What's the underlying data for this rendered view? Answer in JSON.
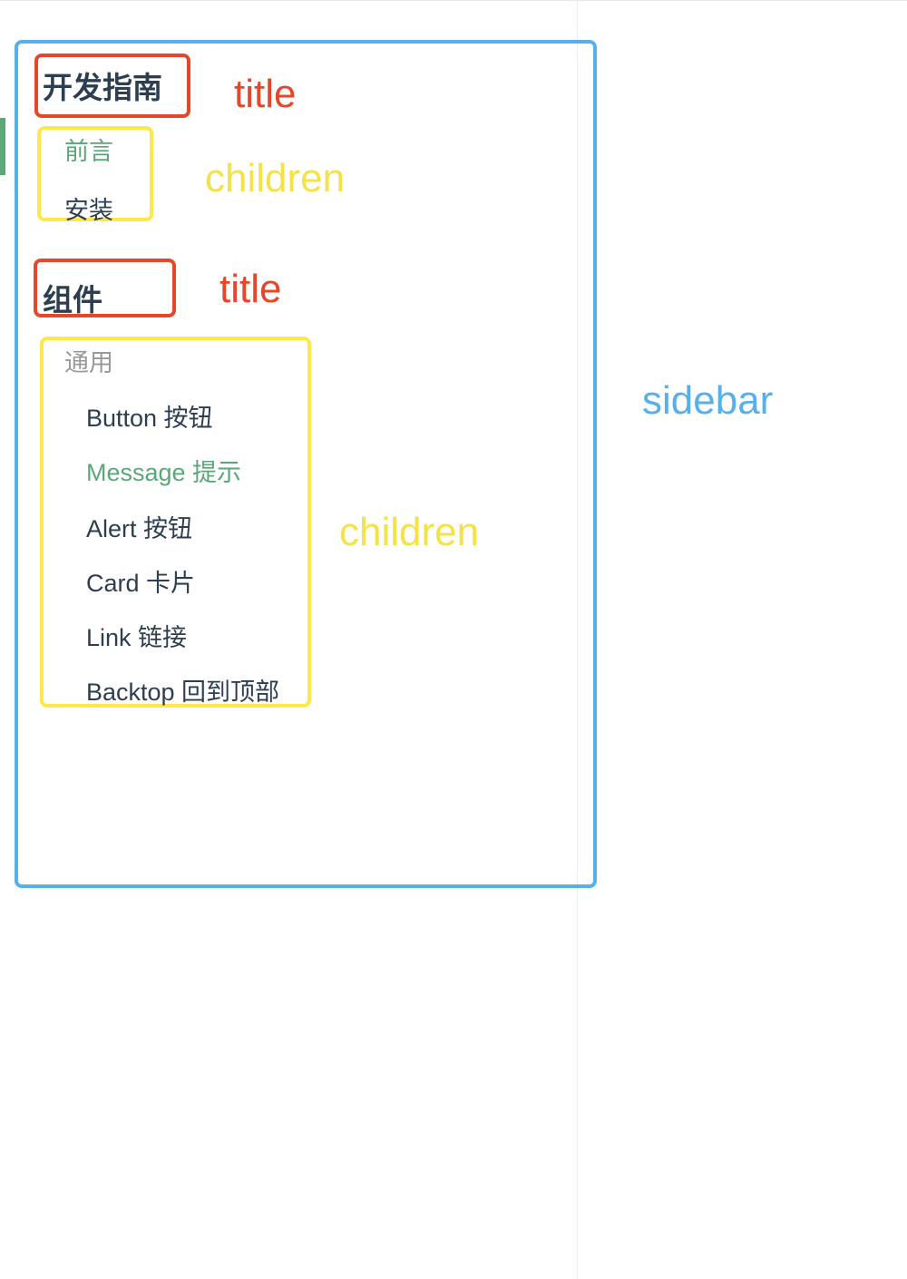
{
  "sidebar": {
    "sections": [
      {
        "title": "开发指南",
        "children": [
          {
            "label": "前言",
            "active": true
          },
          {
            "label": "安装",
            "active": false
          }
        ]
      },
      {
        "title": "组件",
        "group_label": "通用",
        "children": [
          {
            "label": "Button 按钮",
            "active": false
          },
          {
            "label": "Message 提示",
            "active": true
          },
          {
            "label": "Alert 按钮",
            "active": false
          },
          {
            "label": "Card 卡片",
            "active": false
          },
          {
            "label": "Link 链接",
            "active": false
          },
          {
            "label": "Backtop 回到顶部",
            "active": false
          }
        ]
      }
    ]
  },
  "annotations": {
    "title_1": "title",
    "children_1": "children",
    "title_2": "title",
    "children_2": "children",
    "sidebar": "sidebar"
  },
  "colors": {
    "active": "#5aa877",
    "text": "#2c3e50",
    "muted": "#999999",
    "annotation_title": "#e6472b",
    "annotation_children": "#fde84a",
    "annotation_sidebar": "#56b0ec"
  }
}
